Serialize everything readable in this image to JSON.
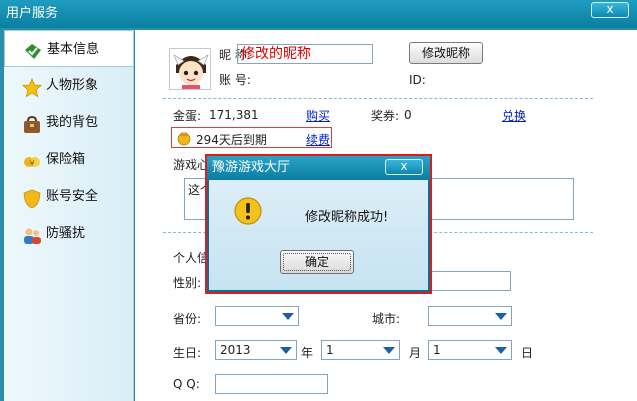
{
  "window": {
    "title": "用户服务",
    "close_label": "x"
  },
  "sidebar": {
    "items": [
      {
        "label": "基本信息",
        "icon": "check-tag-icon",
        "active": true
      },
      {
        "label": "人物形象",
        "icon": "star-icon",
        "active": false
      },
      {
        "label": "我的背包",
        "icon": "bag-icon",
        "active": false
      },
      {
        "label": "保险箱",
        "icon": "safe-icon",
        "active": false
      },
      {
        "label": "账号安全",
        "icon": "shield-icon",
        "active": false
      },
      {
        "label": "防骚扰",
        "icon": "users-icon",
        "active": false
      }
    ]
  },
  "profile": {
    "nickname_label": "昵  称:",
    "nickname_value": "修改的昵称",
    "change_nick_button": "修改昵称",
    "account_label": "账  号:",
    "id_label": "ID:"
  },
  "wealth": {
    "gold_label": "金蛋:",
    "gold_value": "171,381",
    "buy_link": "购买",
    "ticket_label": "奖券:",
    "ticket_value": "0",
    "exchange_link": "兑换"
  },
  "membership": {
    "expire_text": "294天后到期",
    "renew_link": "续费"
  },
  "mood": {
    "label": "游戏心",
    "text": "这个"
  },
  "personal": {
    "section_label": "个人信",
    "gender_label": "性别:",
    "province_label": "省份:",
    "city_label": "城市:",
    "birthday_label": "生日:",
    "year_value": "2013",
    "year_unit": "年",
    "month_value": "1",
    "month_unit": "月",
    "day_value": "1",
    "day_unit": "日",
    "qq_label": "Q Q:"
  },
  "dialog": {
    "title": "豫游游戏大厅",
    "close_label": "x",
    "message": "修改昵称成功!",
    "ok_label": "确定"
  }
}
